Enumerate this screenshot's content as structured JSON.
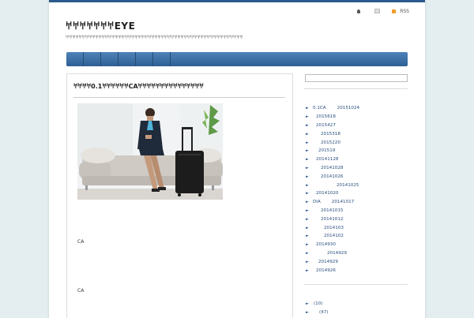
{
  "header": {
    "title": "𐀀𐀀𐀀𐀀𐀀𐀀𐀀EYE",
    "description": "𐀀𐀀𐀀𐀀𐀀𐀀𐀀𐀀𐀀𐀀𐀀𐀀𐀀𐀀𐀀𐀀𐀀𐀀𐀀𐀀𐀀𐀀𐀀𐀀𐀀𐀀𐀀𐀀𐀀𐀀𐀀𐀀𐀀𐀀𐀀𐀀𐀀𐀀𐀀𐀀𐀀𐀀𐀀𐀀𐀀𐀀𐀀𐀀𐀀𐀀𐀀𐀀𐀀𐀀",
    "rss_label": "RSS"
  },
  "nav": {
    "items": [
      "",
      "",
      "",
      "",
      "",
      ""
    ]
  },
  "post": {
    "title": "𐀀𐀀𐀀𐀀0.1𐀀𐀀𐀀𐀀𐀀𐀀CA𐀀𐀀𐀀𐀀𐀀𐀀𐀀𐀀𐀀𐀀𐀀𐀀𐀀𐀀𐀀",
    "text1": "CA",
    "text2": "CA"
  },
  "sidebar": {
    "archives": [
      {
        "label": "0.1CA",
        "date": "20151024",
        "indent": 0
      },
      {
        "label": "",
        "date": "2015618",
        "indent": 0
      },
      {
        "label": "",
        "date": "2015427",
        "indent": 0
      },
      {
        "label": "",
        "date": "2015318",
        "indent": 6
      },
      {
        "label": "",
        "date": "2015220",
        "indent": 6
      },
      {
        "label": "",
        "date": "201519",
        "indent": 3
      },
      {
        "label": "",
        "date": "20141128",
        "indent": 0
      },
      {
        "label": "",
        "date": "20141028",
        "indent": 6
      },
      {
        "label": "",
        "date": "20141026",
        "indent": 6
      },
      {
        "label": "",
        "date": "20141025",
        "indent": 26
      },
      {
        "label": "",
        "date": "20141020",
        "indent": 0
      },
      {
        "label": "DIA",
        "date": "20141017",
        "indent": 0
      },
      {
        "label": "",
        "date": "20141015",
        "indent": 6
      },
      {
        "label": "",
        "date": "20141012",
        "indent": 6
      },
      {
        "label": "",
        "date": "2014103",
        "indent": 10
      },
      {
        "label": "",
        "date": "2014102",
        "indent": 10
      },
      {
        "label": "",
        "date": "2014930",
        "indent": 0
      },
      {
        "label": "",
        "date": "2014929",
        "indent": 14
      },
      {
        "label": "",
        "date": "2014929",
        "indent": 3
      },
      {
        "label": "",
        "date": "2014926",
        "indent": 0
      }
    ],
    "categories": [
      {
        "label": "(10)"
      },
      {
        "label": "(47)"
      }
    ]
  }
}
